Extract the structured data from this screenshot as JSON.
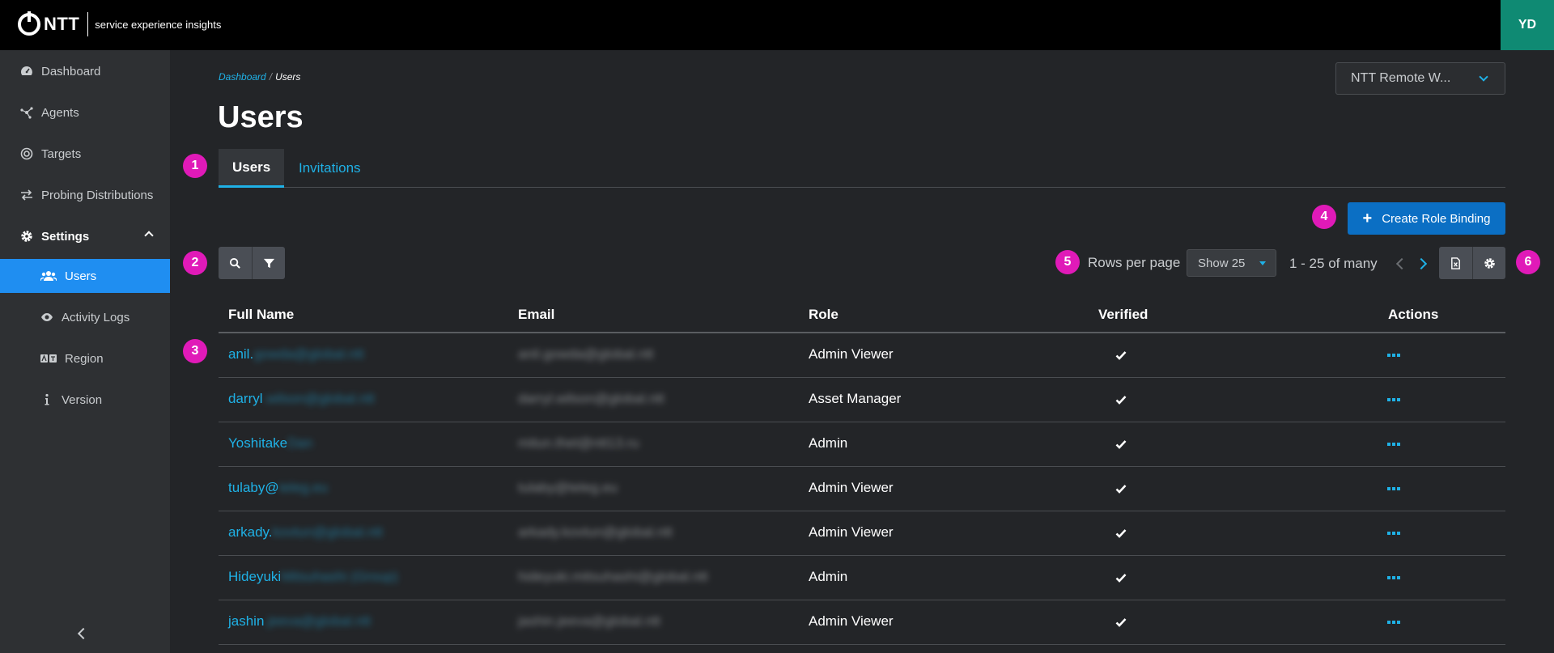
{
  "header": {
    "logo_text": "NTT",
    "app_name": "service experience insights",
    "user_initials": "YD"
  },
  "sidebar": {
    "items": [
      {
        "label": "Dashboard",
        "icon": "gauge-icon"
      },
      {
        "label": "Agents",
        "icon": "network-icon"
      },
      {
        "label": "Targets",
        "icon": "target-icon"
      },
      {
        "label": "Probing Distributions",
        "icon": "arrows-exchange-icon"
      },
      {
        "label": "Settings",
        "icon": "gear-icon",
        "expanded": true
      }
    ],
    "sub_items": [
      {
        "label": "Users",
        "icon": "users-icon",
        "active": true
      },
      {
        "label": "Activity Logs",
        "icon": "eye-icon"
      },
      {
        "label": "Region",
        "icon": "region-icon"
      },
      {
        "label": "Version",
        "icon": "info-icon"
      }
    ]
  },
  "breadcrumb": {
    "root": "Dashboard",
    "separator": "/",
    "current": "Users"
  },
  "page_title": "Users",
  "org_selector": {
    "value": "NTT Remote W..."
  },
  "tabs": [
    {
      "label": "Users",
      "active": true
    },
    {
      "label": "Invitations",
      "active": false
    }
  ],
  "markers": [
    "1",
    "2",
    "3",
    "4",
    "5",
    "6"
  ],
  "create_button": {
    "label": "Create Role Binding",
    "icon": "plus-icon"
  },
  "toolbar": {
    "search_icon": "search-icon",
    "filter_icon": "filter-icon",
    "export_icon": "export-file-icon",
    "settings_icon": "gear-icon"
  },
  "pagination": {
    "rows_label": "Rows per page",
    "rows_value": "Show 25",
    "range": "1 - 25 of many"
  },
  "table": {
    "columns": [
      "Full Name",
      "Email",
      "Role",
      "Verified",
      "Actions"
    ],
    "rows": [
      {
        "name": "anil.",
        "name_blurred": "gowda@global.ntt",
        "email": "anil.gowda@global.ntt",
        "role": "Admin Viewer",
        "verified": true
      },
      {
        "name": "darryl",
        "name_blurred": ".wilson@global.ntt",
        "email": "darryl.wilson@global.ntt",
        "role": "Asset Manager",
        "verified": true
      },
      {
        "name": "Yoshitake",
        "name_blurred": "Dan",
        "email": "mitun.thet@ntt13.ru",
        "role": "Admin",
        "verified": true
      },
      {
        "name": "tulaby@",
        "name_blurred": "teleg.eu",
        "email": "tulaby@teleg.eu",
        "role": "Admin Viewer",
        "verified": true
      },
      {
        "name": "arkady.",
        "name_blurred": "kovtun@global.ntt",
        "email": "arkady.kovtun@global.ntt",
        "role": "Admin Viewer",
        "verified": true
      },
      {
        "name": "Hideyuki",
        "name_blurred": "Mitsuhashi (Group)",
        "email": "hideyuki.mitsuhashi@global.ntt",
        "role": "Admin",
        "verified": true
      },
      {
        "name": "jashin",
        "name_blurred": ".jeeva@global.ntt",
        "email": "jashin.jeeva@global.ntt",
        "role": "Admin Viewer",
        "verified": true
      }
    ]
  },
  "colors": {
    "accent": "#1fb1e6",
    "active_nav": "#1f8ef1",
    "primary_button": "#0b6fc4",
    "marker": "#e01ab8",
    "avatar": "#0f8a73"
  }
}
